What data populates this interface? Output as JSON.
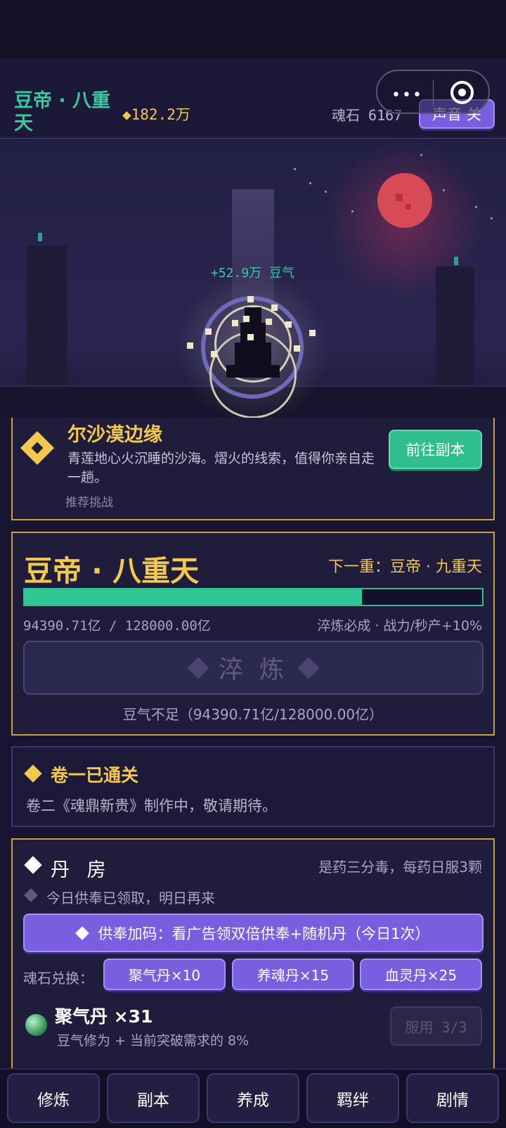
{
  "header": {
    "realm": "豆帝 · 八重天",
    "gold": "◆182.2万",
    "soulstone": "魂石 6167",
    "sound_button": "声音 关"
  },
  "capsule": {
    "more_label": "•••",
    "target_icon": "target-icon"
  },
  "scene": {
    "gain_text": "+52.9万 豆气"
  },
  "dungeon": {
    "name": "尔沙漠边缘",
    "description": "青莲地心火沉睡的沙海。熠火的线索，值得你亲自走一趟。",
    "tag": "推荐挑战",
    "goto_button": "前往副本"
  },
  "realm": {
    "title": "豆帝 · 八重天",
    "next": "下一重：豆帝 · 九重天",
    "progress_text": "94390.71亿 / 128000.00亿",
    "progress_fraction": 0.737,
    "bonus": "淬炼必成 · 战力/秒产+10%",
    "refine_button": "淬 炼",
    "insufficient": "豆气不足（94390.71亿/128000.00亿）"
  },
  "story": {
    "title": "卷一已通关",
    "description": "卷二《魂鼎新贵》制作中，敬请期待。"
  },
  "alchemy": {
    "title": "丹 房",
    "note": "是药三分毒，每药日服3颗",
    "daily_note": "今日供奉已领取，明日再来",
    "ad_button": "供奉加码：看广告领双倍供奉+随机丹（今日1次）",
    "exchange_label": "魂石兑换：",
    "exchange_options": [
      "聚气丹×10",
      "养魂丹×15",
      "血灵丹×25"
    ],
    "pill": {
      "name": "聚气丹 ×31",
      "effect": "豆气修为 + 当前突破需求的 8%",
      "use_button": "服用 3/3"
    }
  },
  "nav": {
    "items": [
      "修炼",
      "副本",
      "养成",
      "羁绊",
      "剧情"
    ]
  },
  "colors": {
    "accent_gold": "#f2c94c",
    "accent_green": "#2fc794",
    "accent_purple": "#7a5ee0",
    "moon_red": "#d84a55"
  }
}
